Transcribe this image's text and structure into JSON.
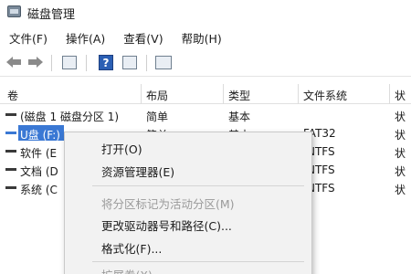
{
  "window": {
    "title": "磁盘管理"
  },
  "menubar": [
    {
      "label": "文件(F)"
    },
    {
      "label": "操作(A)"
    },
    {
      "label": "查看(V)"
    },
    {
      "label": "帮助(H)"
    }
  ],
  "toolbar": {
    "icons": [
      "back-arrow-icon",
      "forward-arrow-icon",
      "properties-icon",
      "help-icon",
      "view-icon",
      "list-icon"
    ]
  },
  "table": {
    "headers": [
      "卷",
      "布局",
      "类型",
      "文件系统",
      "状"
    ],
    "rows": [
      {
        "volume": "(磁盘 1 磁盘分区 1)",
        "layout": "简单",
        "type": "基本",
        "fs": "",
        "status": "状"
      },
      {
        "volume": "U盘 (F:)",
        "layout": "简单",
        "type": "基本",
        "fs": "FAT32",
        "status": "状",
        "selected": true
      },
      {
        "volume": "软件 (E",
        "layout": "",
        "type": "",
        "fs": "NTFS",
        "status": "状"
      },
      {
        "volume": "文档 (D",
        "layout": "",
        "type": "",
        "fs": "NTFS",
        "status": "状"
      },
      {
        "volume": "系统 (C",
        "layout": "",
        "type": "",
        "fs": "NTFS",
        "status": "状"
      }
    ]
  },
  "context_menu": {
    "items": [
      {
        "label": "打开(O)",
        "enabled": true
      },
      {
        "label": "资源管理器(E)",
        "enabled": true
      },
      {
        "separator": true
      },
      {
        "label": "将分区标记为活动分区(M)",
        "enabled": false
      },
      {
        "label": "更改驱动器号和路径(C)...",
        "enabled": true
      },
      {
        "label": "格式化(F)...",
        "enabled": true
      },
      {
        "separator": true
      },
      {
        "label": "扩展卷(X)...",
        "enabled": false
      }
    ]
  },
  "colors": {
    "selection": "#3a78d4",
    "menu_bg": "#f2f2f2",
    "disabled_text": "#9a9a9a"
  }
}
